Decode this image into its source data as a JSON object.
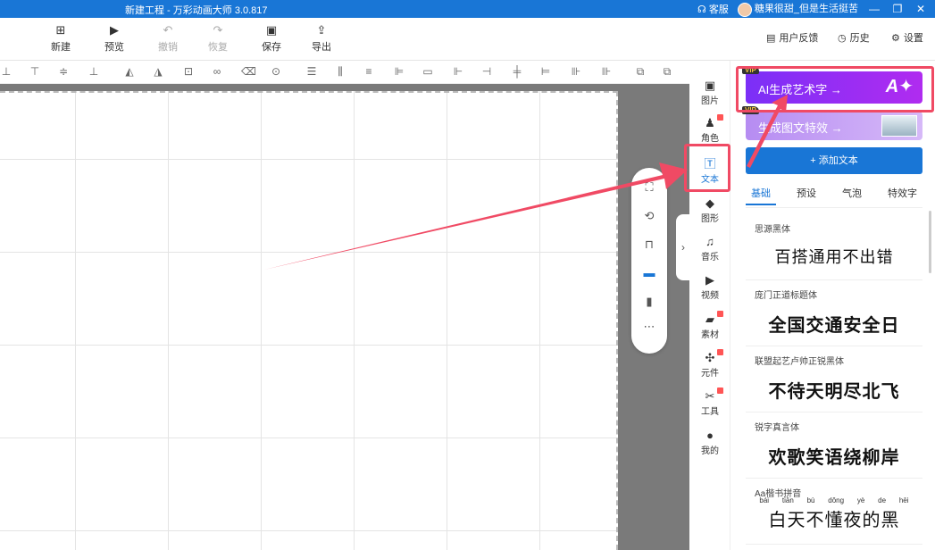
{
  "window": {
    "title": "新建工程 - 万彩动画大师 3.0.817",
    "service_label": "客服",
    "username": "糖果很甜_但是生活挺苦",
    "colors": {
      "titlebar": "#1976d6",
      "accent": "#1976d6",
      "highlight": "#f04a64"
    }
  },
  "toolbar": {
    "new_label": "新建",
    "preview_label": "预览",
    "undo_label": "撤销",
    "redo_label": "恢复",
    "save_label": "保存",
    "export_label": "导出",
    "feedback_label": "用户反馈",
    "history_label": "历史",
    "settings_label": "设置"
  },
  "rail": {
    "items": [
      {
        "label": "图片",
        "icon": "image-icon"
      },
      {
        "label": "角色",
        "icon": "person-icon",
        "badge": true
      },
      {
        "label": "文本",
        "icon": "text-icon",
        "active": true
      },
      {
        "label": "图形",
        "icon": "shape-icon"
      },
      {
        "label": "音乐",
        "icon": "music-icon"
      },
      {
        "label": "视频",
        "icon": "video-icon"
      },
      {
        "label": "素材",
        "icon": "folder-icon",
        "badge": true
      },
      {
        "label": "元件",
        "icon": "pinwheel-icon",
        "badge": true
      },
      {
        "label": "工具",
        "icon": "wrench-icon",
        "badge": true
      },
      {
        "label": "我的",
        "icon": "user-icon"
      }
    ]
  },
  "panel": {
    "ai_art_label": "AI生成艺术字 →",
    "ai_art_badge": "VIP",
    "effect_label": "生成图文特效 →",
    "effect_badge": "VIP",
    "add_text_label": "+ 添加文本",
    "tabs": [
      "基础",
      "预设",
      "气泡",
      "特效字"
    ],
    "active_tab": "基础",
    "fonts": [
      {
        "name": "思源黑体",
        "sample": "百搭通用不出错"
      },
      {
        "name": "庞门正道标题体",
        "sample": "全国交通安全日"
      },
      {
        "name": "联盟起艺卢帅正锐黑体",
        "sample": "不待天明尽北飞"
      },
      {
        "name": "锐字真言体",
        "sample": "欢歌笑语绕柳岸"
      },
      {
        "name": "Aa楷书拼音",
        "sample": "白天不懂夜的黑",
        "pinyin": [
          "bái",
          "tiān",
          "bù",
          "dǒng",
          "yè",
          "de",
          "hēi"
        ]
      }
    ]
  }
}
